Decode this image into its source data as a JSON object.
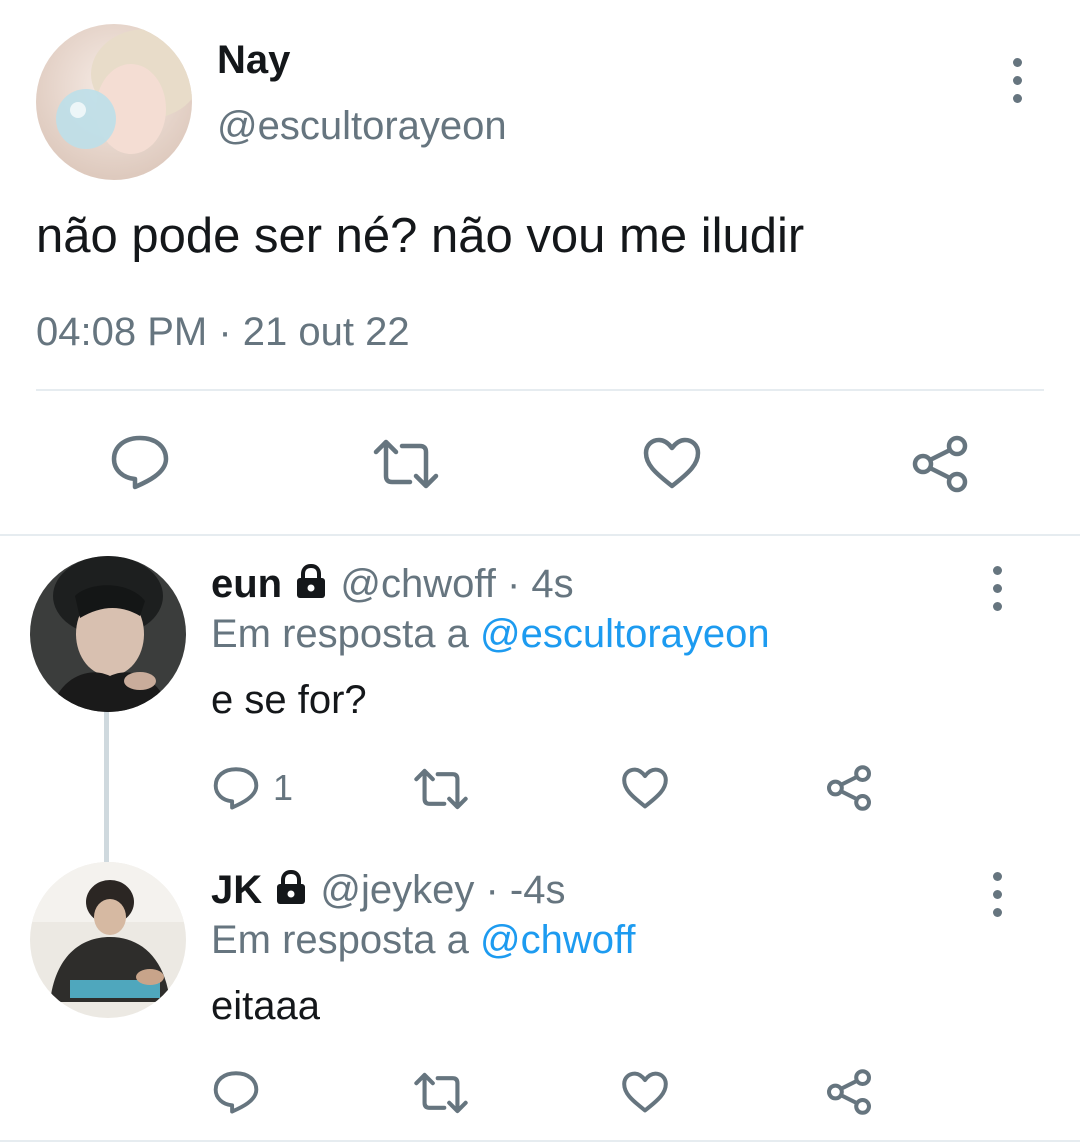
{
  "main_tweet": {
    "name": "Nay",
    "handle": "@escultorayeon",
    "text": "não pode ser né? não vou me iludir",
    "timestamp": "04:08 PM · 21 out 22"
  },
  "replies": [
    {
      "name": "eun",
      "handle": "@chwoff",
      "time": "· 4s",
      "reply_prefix": "Em resposta a",
      "reply_to": "@escultorayeon",
      "text": "e se for?",
      "reply_count": "1"
    },
    {
      "name": "JK",
      "handle": "@jeykey",
      "time": "· -4s",
      "reply_prefix": "Em resposta a",
      "reply_to": "@chwoff",
      "text": "eitaaa",
      "reply_count": ""
    }
  ],
  "icons": {
    "reply": "speech-bubble-icon",
    "retweet": "retweet-icon",
    "like": "heart-icon",
    "share": "share-icon",
    "more": "more-vertical-icon",
    "locked": "lock-icon"
  },
  "colors": {
    "text": "#14171a",
    "secondary": "#66757f",
    "link": "#1d9bf0",
    "divider": "#e6ecf0"
  }
}
